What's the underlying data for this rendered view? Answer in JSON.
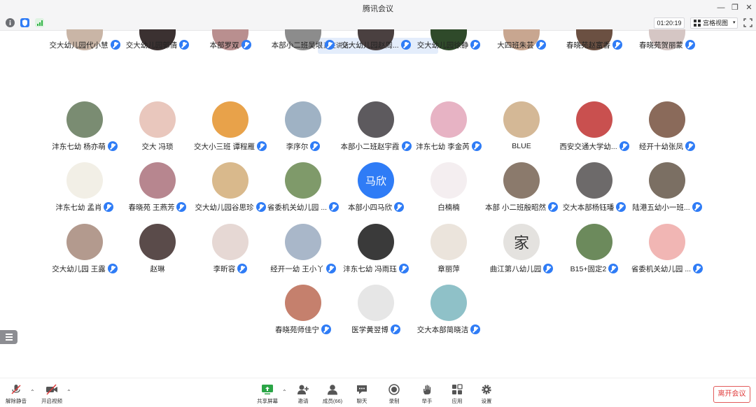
{
  "window": {
    "title": "腾讯会议"
  },
  "infobar": {
    "timer": "01:20:19",
    "view_label": "宫格视图"
  },
  "speaking": {
    "label": "正在讲话:"
  },
  "participants": [
    [
      "交大幼儿园代小慧",
      "交大幼儿园郭倩",
      "本部罗双",
      "本部小二班吴垠",
      "交大幼儿园赵周...",
      "交大幼儿园徐静",
      "大四班朱芸",
      "春晓苑赵富香",
      "春晓苑贺丽蒙"
    ],
    [
      "沣东七幼 杨亦萌",
      "交大 冯琐",
      "交大小三班 谭程雁",
      "李序尔",
      "本部小二班赵宇霞",
      "沣东七幼 李金芮",
      "BLUE",
      "西安交通大学幼...",
      "经开十幼张凤"
    ],
    [
      "沣东七幼 孟肖",
      "春晓苑 王燕芳",
      "交大幼儿园谷思珍",
      "省委机关幼儿园 ...",
      "本部小四马欣",
      "白楠楠",
      "本部 小二班殷昭然",
      "交大本部杨钰璠",
      "陆港五幼小一班..."
    ],
    [
      "交大幼儿园 王露",
      "赵琳",
      "李昕容",
      "经开一幼 王小丫",
      "沣东七幼 冯雨珏",
      "章丽萍",
      "曲江第八幼儿园",
      "B15+固定2",
      "省委机关幼儿园 ..."
    ],
    [
      "春晓苑师佳宁",
      "医学黄翌博",
      "交大本部简晓洁"
    ]
  ],
  "avatar_texts": {
    "row2_col4": "马欣",
    "row3_col6": "家"
  },
  "toolbar": {
    "mute": "解除静音",
    "video": "开启视频",
    "share": "共享屏幕",
    "invite": "邀请",
    "members": "成员(66)",
    "chat": "聊天",
    "record": "录制",
    "raise_hand": "举手",
    "apps": "应用",
    "settings": "设置",
    "leave": "离开会议"
  },
  "colors": {
    "accent": "#2f7cf6",
    "leave": "#e03c3c",
    "banner": "#e4edfb"
  }
}
